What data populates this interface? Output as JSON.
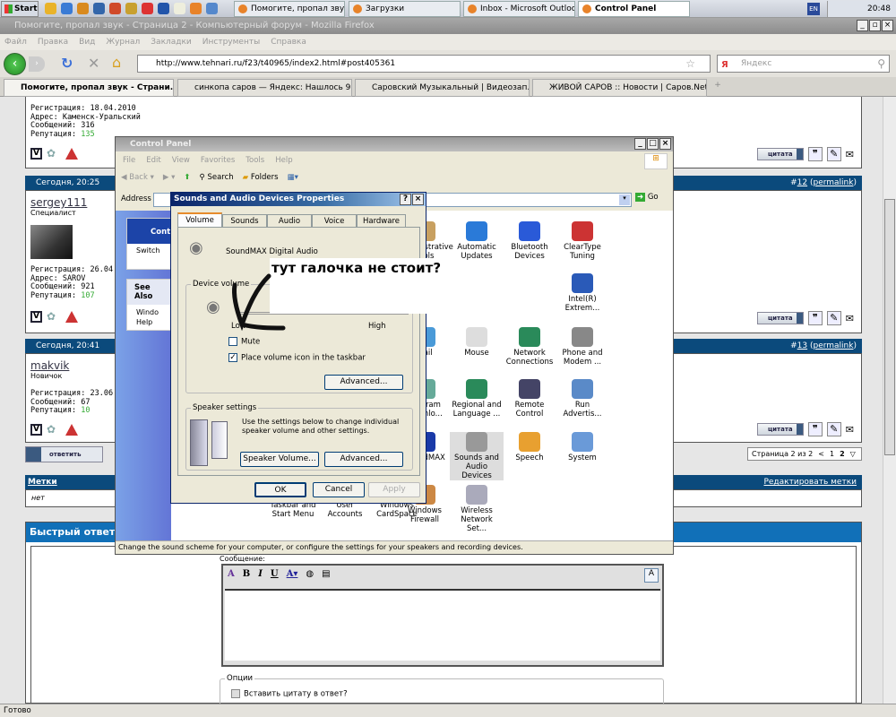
{
  "taskbar": {
    "start": "Start",
    "buttons": [
      "Помогите, пропал звук ...",
      "Загрузки",
      "Inbox - Microsoft Outlook",
      "Control Panel"
    ],
    "lang": "EN",
    "clock": "20:48"
  },
  "firefox": {
    "title": "Помогите, пропал звук - Страница 2 - Компьютерный форум - Mozilla Firefox",
    "menu": [
      "Файл",
      "Правка",
      "Вид",
      "Журнал",
      "Закладки",
      "Инструменты",
      "Справка"
    ],
    "url": "http://www.tehnari.ru/f23/t40965/index2.html#post405361",
    "search_placeholder": "Яндекс",
    "tabs": [
      "Помогите, пропал звук - Страни...",
      "синкопа саров — Яндекс: Нашлось 9...",
      "Саровский Музыкальный | Видеозап...",
      "ЖИВОЙ САРОВ :: Новости | Саров.Net"
    ],
    "status": "Готово"
  },
  "forum": {
    "post0": {
      "reg": "Регистрация: 18.04.2010",
      "addr": "Адрес: Каменск-Уральский",
      "msgs": "Сообщений: 316",
      "rep_label": "Репутация: ",
      "rep": "135"
    },
    "post1": {
      "date": "Сегодня, 20:25",
      "num_prefix": "#",
      "num": "12",
      "permalink": "permalink",
      "user": "sergey111",
      "rank": "Специалист",
      "reg": "Регистрация: 26.04.2",
      "addr": "Адрес: SAROV",
      "msgs": "Сообщений: 921",
      "rep_label": "Репутация: ",
      "rep": "107"
    },
    "post2": {
      "date": "Сегодня, 20:41",
      "num_prefix": "#",
      "num": "13",
      "permalink": "permalink",
      "user": "makvik",
      "rank": "Новичок",
      "reg": "Регистрация: 23.06.2",
      "msgs": "Сообщений: 67",
      "rep_label": "Репутация: ",
      "rep": "10"
    },
    "quote_label": "цитата",
    "reply_label": "ответить",
    "pagination": {
      "label": "Страница 2 из 2",
      "prev": "<",
      "pages": [
        "1",
        "2"
      ]
    },
    "tags": {
      "title": "Метки",
      "value": "нет",
      "edit": "Редактировать метки"
    },
    "quick_reply": {
      "title": "Быстрый ответ",
      "message_label": "Сообщение:",
      "options_label": "Опции",
      "insert_quote": "Вставить цитату в ответ?"
    }
  },
  "control_panel": {
    "title": "Control Panel",
    "menu": [
      "File",
      "Edit",
      "View",
      "Favorites",
      "Tools",
      "Help"
    ],
    "toolbar": {
      "back": "Back",
      "search": "Search",
      "folders": "Folders"
    },
    "address_label": "Address",
    "go": "Go",
    "left": {
      "cp": "Control",
      "switch": "Switch",
      "see_also": "See Also",
      "windows": "Windo",
      "help": "Help"
    },
    "items": [
      [
        "Administrative Tools",
        "Automatic Updates",
        "Bluetooth Devices",
        "ClearType Tuning"
      ],
      [
        "",
        "",
        "",
        "Intel(R) Extrem..."
      ],
      [
        "Mail",
        "Mouse",
        "Network Connections",
        "Phone and Modem ..."
      ],
      [
        "Program Downlo...",
        "Regional and Language ...",
        "Remote Control",
        "Run Advertis..."
      ],
      [
        "SoundMAX",
        "Sounds and Audio Devices",
        "Speech",
        "System"
      ],
      [
        "Windows Firewall",
        "Wireless Network Set...",
        "",
        ""
      ]
    ],
    "hidden_items": [
      "Taskbar and Start Menu",
      "User Accounts",
      "Windows CardSpace"
    ],
    "status": "Change the sound scheme for your computer, or configure the settings for your speakers and recording devices."
  },
  "dialog": {
    "title": "Sounds and Audio Devices Properties",
    "tabs": [
      "Volume",
      "Sounds",
      "Audio",
      "Voice",
      "Hardware"
    ],
    "device": "SoundMAX Digital Audio",
    "device_volume": "Device volume",
    "low": "Low",
    "high": "High",
    "mute": "Mute",
    "mute_checked": false,
    "place_icon": "Place volume icon in the taskbar",
    "place_icon_checked": true,
    "advanced": "Advanced...",
    "speaker_settings": "Speaker settings",
    "speaker_text": "Use the settings below to change individual speaker volume and other settings.",
    "speaker_volume": "Speaker Volume...",
    "ok": "OK",
    "cancel": "Cancel",
    "apply": "Apply"
  },
  "annotation": "тут галочка не стоит?"
}
